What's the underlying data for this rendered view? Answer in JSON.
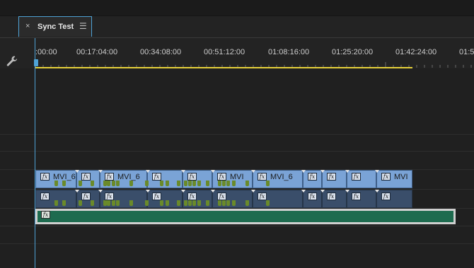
{
  "tab": {
    "close": "×",
    "title": "Sync Test",
    "menu": "☰"
  },
  "ruler": {
    "labels": [
      ":00:00",
      "00:17:04:00",
      "00:34:08:00",
      "00:51:12:00",
      "01:08:16:00",
      "01:25:20:00",
      "01:42:24:00",
      "01:5"
    ]
  },
  "icons": {
    "settings": "wrench-icon"
  },
  "video_clips": [
    {
      "name": "MVI_6"
    },
    {
      "name": ""
    },
    {
      "name": "MVI_6"
    },
    {
      "name": ""
    },
    {
      "name": ""
    },
    {
      "name": "MVI"
    },
    {
      "name": "MVI_6"
    },
    {
      "name": ""
    },
    {
      "name": ""
    },
    {
      "name": ""
    },
    {
      "name": "MVI"
    }
  ],
  "fx_label": "fx",
  "colors": {
    "accent": "#4fa3d6",
    "work_area": "#e6d13a",
    "video": "#7aa3d6",
    "audio": "#3a4e6a",
    "green_track": "#1e6b4f"
  }
}
